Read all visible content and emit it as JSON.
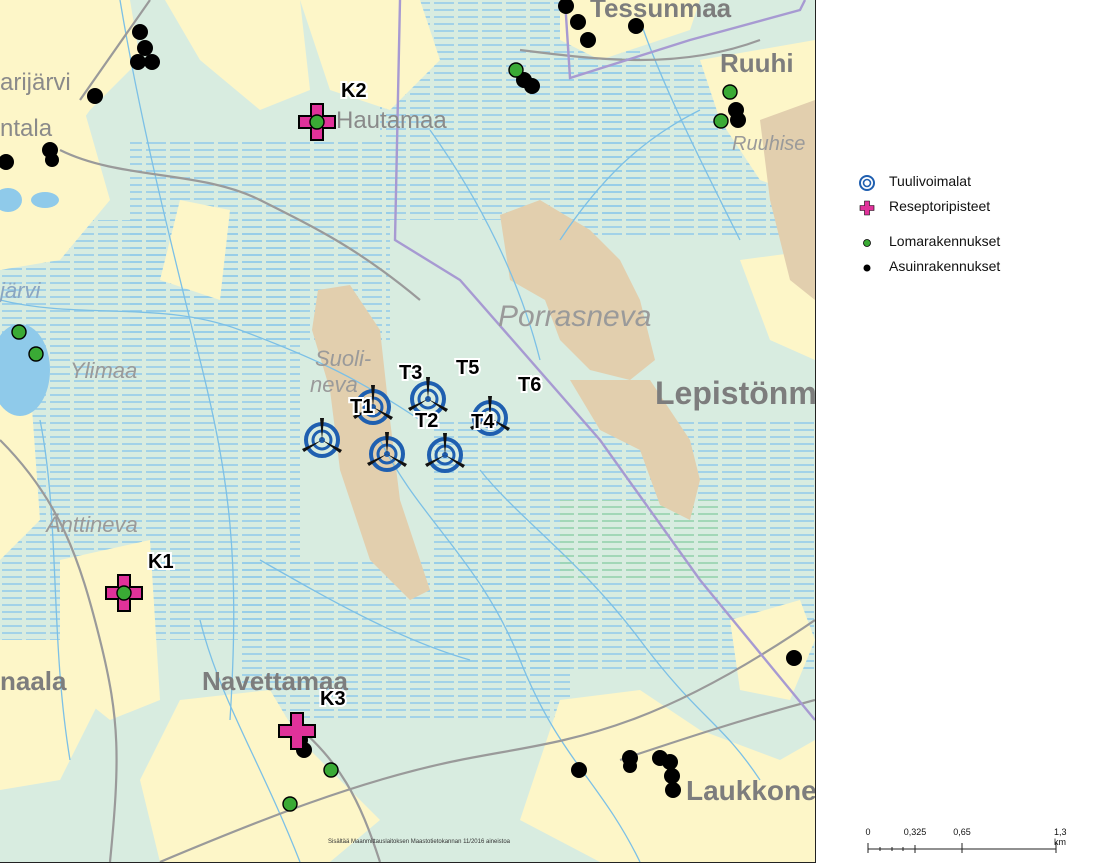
{
  "map": {
    "place_names": {
      "tessunmaa": "Tessunmaa",
      "ruuhi": "Ruuhi",
      "arijarvi": "arijärvi",
      "ntala": "ntala",
      "hautamaa": "Hautamaa",
      "ruuhise": "Ruuhise",
      "jarvi": "järvi",
      "porrasneva": "Porrasneva",
      "suolineva_1": "Suoli-",
      "suolineva_2": "neva",
      "ylimaa": "Ylimaa",
      "lepistonm": "Lepistönm",
      "anttineva": "Änttineva",
      "naala": "naala",
      "navettamaa": "Navettamaa",
      "laukkone": "Laukkone"
    },
    "receptors": [
      {
        "label": "K1"
      },
      {
        "label": "K2"
      },
      {
        "label": "K3"
      }
    ],
    "turbines": [
      {
        "label": "T1"
      },
      {
        "label": "T2"
      },
      {
        "label": "T3"
      },
      {
        "label": "T4"
      },
      {
        "label": "T5"
      },
      {
        "label": "T6"
      }
    ],
    "credit": "Sisältää Maanmittauslaitoksen Maastotietokannan 11/2016 aineistoa"
  },
  "legend": {
    "items": [
      {
        "label": "Tuulivoimalat",
        "icon": "wind-turbine-target-icon",
        "color": "#1f5fb0"
      },
      {
        "label": "Reseptoripisteet",
        "icon": "pink-cross-icon",
        "color": "#e0329a"
      },
      {
        "label": "Lomarakennukset",
        "icon": "green-dot-icon",
        "color": "#3aaa35"
      },
      {
        "label": "Asuinrakennukset",
        "icon": "black-dot-icon",
        "color": "#000000"
      }
    ]
  },
  "scalebar": {
    "ticks": [
      "0",
      "0,325",
      "0,65",
      "1,3 km"
    ]
  },
  "colors": {
    "forest": "#d8ece0",
    "field": "#fdf6c8",
    "peat": "#e2cfae",
    "water_line": "#8fcaea",
    "road": "#9a9a9a",
    "border": "#a79ad2"
  }
}
